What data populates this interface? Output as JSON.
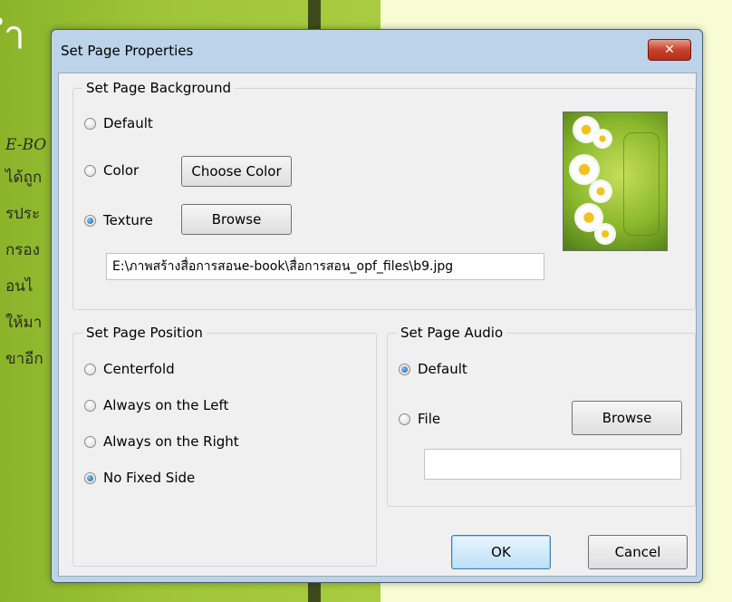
{
  "background": {
    "heading": "ำ",
    "lines": [
      "E-BO",
      "ได้ถูก",
      "รประ",
      "กรอง",
      "อนไ",
      "ให้มา",
      "ขาอีก"
    ]
  },
  "dialog": {
    "title": "Set Page Properties",
    "close_label": "✕",
    "background_group": {
      "legend": "Set Page Background",
      "options": {
        "default": "Default",
        "color": "Color",
        "texture": "Texture"
      },
      "selected": "texture",
      "choose_color_label": "Choose Color",
      "browse_label": "Browse",
      "texture_path": "E:\\ภาพสร้างสื่อการสอนe-book\\สื่อการสอน_opf_files\\b9.jpg"
    },
    "position_group": {
      "legend": "Set Page Position",
      "options": [
        "Centerfold",
        "Always on the Left",
        "Always on the Right",
        "No Fixed Side"
      ],
      "selected": "No Fixed Side"
    },
    "audio_group": {
      "legend": "Set Page Audio",
      "options": {
        "default": "Default",
        "file": "File"
      },
      "selected": "default",
      "browse_label": "Browse",
      "file_path": ""
    },
    "ok_label": "OK",
    "cancel_label": "Cancel"
  },
  "colors": {
    "titlebar": "#bcd3ea",
    "close_button": "#c5432c",
    "background_green": "#9ec438"
  }
}
